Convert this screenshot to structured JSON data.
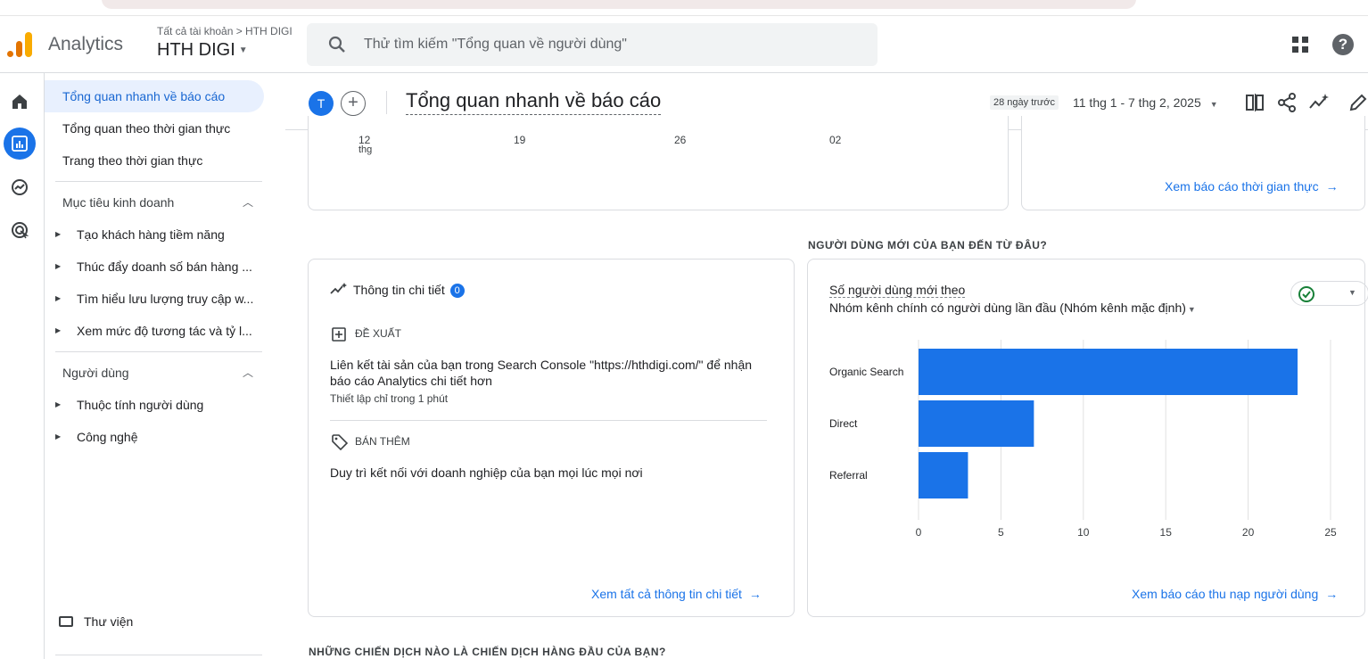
{
  "app": {
    "name": "Analytics",
    "breadcrumb": "Tất cả tài khoản > HTH DIGI",
    "property": "HTH DIGI",
    "search_placeholder": "Thử tìm kiếm \"Tổng quan về người dùng\""
  },
  "nav": {
    "items": [
      "Tổng quan nhanh về báo cáo",
      "Tổng quan theo thời gian thực",
      "Trang theo thời gian thực"
    ],
    "section_business": "Mục tiêu kinh doanh",
    "business_items": [
      "Tạo khách hàng tiềm năng",
      "Thúc đẩy doanh số bán hàng ...",
      "Tìm hiểu lưu lượng truy cập w...",
      "Xem mức độ tương tác và tỷ l..."
    ],
    "section_users": "Người dùng",
    "user_items": [
      "Thuộc tính người dùng",
      "Công nghệ"
    ],
    "library": "Thư viện"
  },
  "header": {
    "avatar": "T",
    "add": "+",
    "title": "Tổng quan nhanh về báo cáo",
    "date_chip": "28 ngày trước",
    "date_range": "11 thg 1 - 7 thg 2, 2025"
  },
  "top_left_card": {
    "ticks": [
      "12",
      "19",
      "26",
      "02"
    ],
    "tick_sub": "thg"
  },
  "top_right_card": {
    "link": "Xem báo cáo thời gian thực"
  },
  "insights": {
    "title": "Thông tin chi tiết",
    "count": "0",
    "suggest_label": "ĐỀ XUẤT",
    "suggest_text": "Liên kết tài sản của bạn trong Search Console \"https://hthdigi.com/\" để nhận báo cáo Analytics chi tiết hơn",
    "suggest_note": "Thiết lập chỉ trong 1 phút",
    "more_label": "BÁN THÊM",
    "more_text": "Duy trì kết nối với doanh nghiệp của bạn mọi lúc mọi nơi",
    "link": "Xem tất cả thông tin chi tiết"
  },
  "new_users": {
    "section_title": "NGƯỜI DÙNG MỚI CỦA BẠN ĐẾN TỪ ĐÂU?",
    "chart_title": "Số người dùng mới theo",
    "chart_sub": "Nhóm kênh chính có người dùng lần đầu (Nhóm kênh mặc định)",
    "link": "Xem báo cáo thu nạp người dùng"
  },
  "campaigns": {
    "section_title": "NHỮNG CHIẾN DỊCH NÀO LÀ CHIẾN DỊCH HÀNG ĐẦU CỦA BẠN?"
  },
  "chart_data": {
    "type": "bar",
    "orientation": "horizontal",
    "categories": [
      "Organic Search",
      "Direct",
      "Referral"
    ],
    "values": [
      23,
      7,
      3
    ],
    "xlim": [
      0,
      25
    ],
    "xticks": [
      "0",
      "5",
      "10",
      "15",
      "20",
      "25"
    ],
    "grid": true,
    "color": "#1a73e8"
  }
}
